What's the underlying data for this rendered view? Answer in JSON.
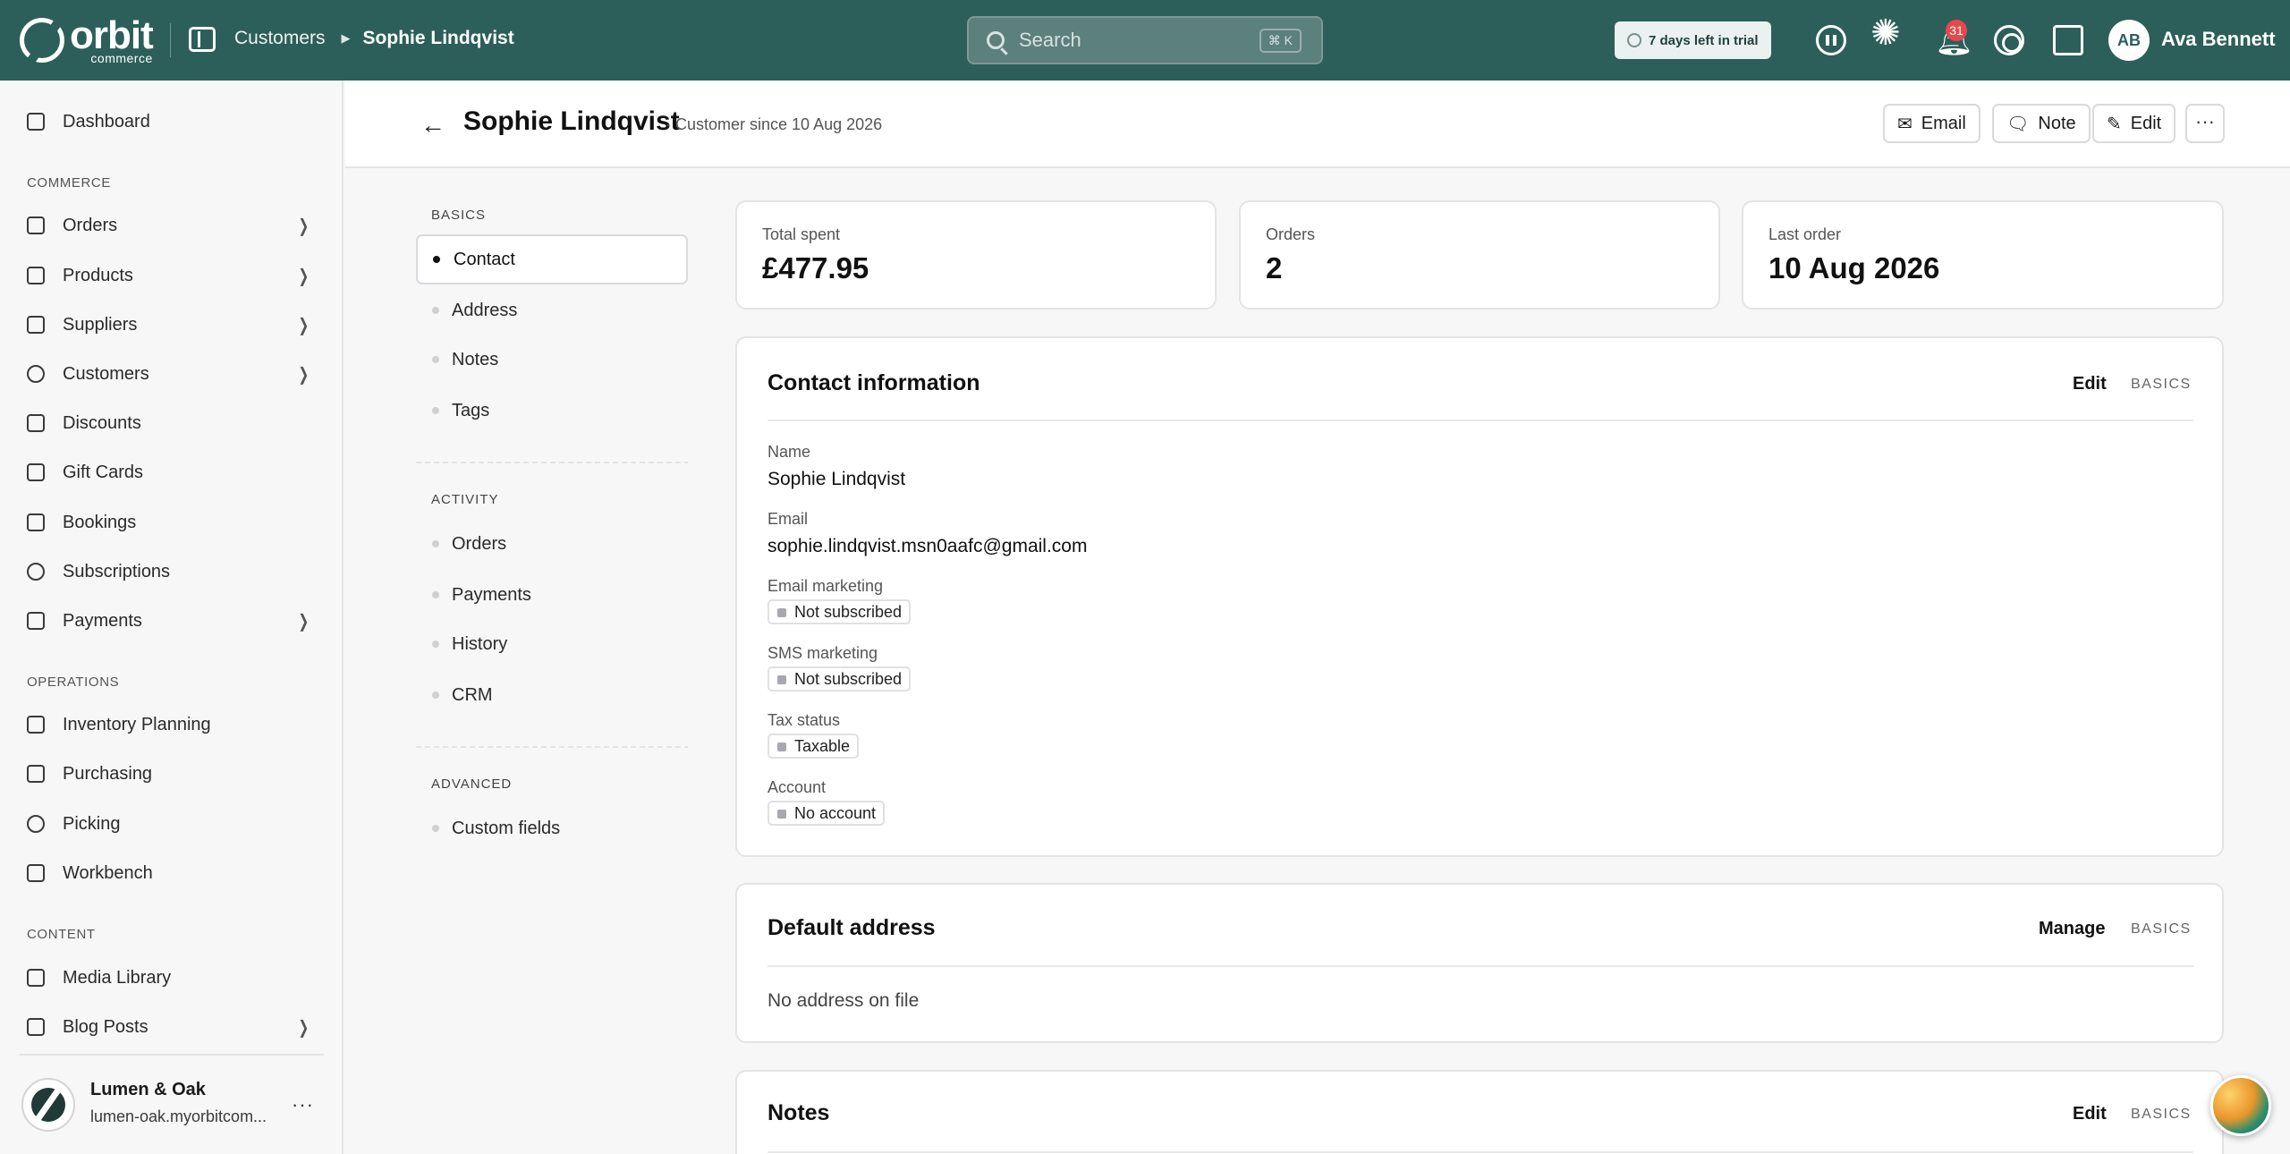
{
  "app": {
    "logo_word": "orbit",
    "logo_sub": "commerce"
  },
  "topbar": {
    "breadcrumb_parent": "Customers",
    "breadcrumb_current": "Sophie Lindqvist",
    "search_placeholder": "Search",
    "search_shortcut": "⌘ K",
    "trial_text": "7 days left in trial",
    "notification_count": "31",
    "user_initials": "AB",
    "user_name": "Ava Bennett"
  },
  "sidebar": {
    "dashboard": "Dashboard",
    "section_commerce": "COMMERCE",
    "commerce_items": [
      {
        "label": "Orders",
        "icon": "inbox-icon"
      },
      {
        "label": "Products",
        "icon": "box-icon"
      },
      {
        "label": "Suppliers",
        "icon": "building-icon"
      },
      {
        "label": "Customers",
        "icon": "users-icon"
      },
      {
        "label": "Discounts",
        "icon": "tag-icon"
      },
      {
        "label": "Gift Cards",
        "icon": "gift-icon"
      },
      {
        "label": "Bookings",
        "icon": "calendar-icon"
      },
      {
        "label": "Subscriptions",
        "icon": "refresh-icon"
      },
      {
        "label": "Payments",
        "icon": "card-icon"
      }
    ],
    "section_operations": "OPERATIONS",
    "operations_items": [
      {
        "label": "Inventory Planning",
        "icon": "clipboard-icon"
      },
      {
        "label": "Purchasing",
        "icon": "box-icon"
      },
      {
        "label": "Picking",
        "icon": "location-pin-icon"
      },
      {
        "label": "Workbench",
        "icon": "box-icon"
      }
    ],
    "section_content": "CONTENT",
    "content_items": [
      {
        "label": "Media Library",
        "icon": "image-icon"
      },
      {
        "label": "Blog Posts",
        "icon": "document-icon"
      }
    ],
    "store_name": "Lumen & Oak",
    "store_url": "lumen-oak.myorbitcom...",
    "store_more": "···"
  },
  "header": {
    "title": "Sophie Lindqvist",
    "subtitle": "· Customer since 10 Aug 2026",
    "email_button": "Email",
    "note_button": "Note",
    "edit_button": "Edit",
    "more_button": "···"
  },
  "section_nav": {
    "basics_label": "BASICS",
    "basics": [
      "Contact",
      "Address",
      "Notes",
      "Tags"
    ],
    "activity_label": "ACTIVITY",
    "activity": [
      "Orders",
      "Payments",
      "History",
      "CRM"
    ],
    "advanced_label": "ADVANCED",
    "advanced": [
      "Custom fields"
    ]
  },
  "stats": {
    "total_spent_label": "Total spent",
    "total_spent_value": "£477.95",
    "orders_label": "Orders",
    "orders_value": "2",
    "last_order_label": "Last order",
    "last_order_value": "10 Aug 2026"
  },
  "contact_panel": {
    "title": "Contact information",
    "action": "Edit",
    "tag": "BASICS",
    "name_label": "Name",
    "name_value": "Sophie Lindqvist",
    "email_label": "Email",
    "email_value": "sophie.lindqvist.msn0aafc@gmail.com",
    "email_marketing_label": "Email marketing",
    "email_marketing_value": "Not subscribed",
    "sms_marketing_label": "SMS marketing",
    "sms_marketing_value": "Not subscribed",
    "tax_label": "Tax status",
    "tax_value": "Taxable",
    "account_label": "Account",
    "account_value": "No account"
  },
  "address_panel": {
    "title": "Default address",
    "action": "Manage",
    "tag": "BASICS",
    "empty": "No address on file"
  },
  "notes_panel": {
    "title": "Notes",
    "action": "Edit",
    "tag": "BASICS"
  }
}
